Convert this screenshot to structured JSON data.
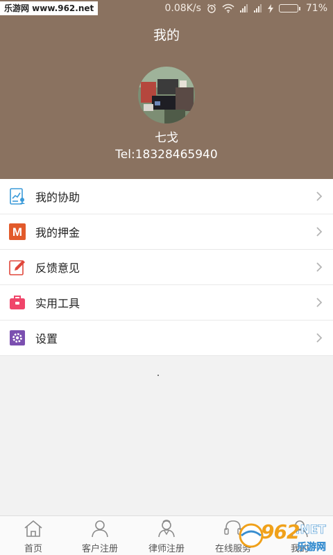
{
  "status_bar": {
    "watermark": "乐游网 www.962.net",
    "speed": "0.08K/s",
    "battery_percent": "71%",
    "battery_level": 0.71
  },
  "header": {
    "title": "我的",
    "username": "七戈",
    "phone": "Tel:18328465940"
  },
  "menu": {
    "items": [
      {
        "label": "我的协助",
        "icon": "assist-chart-icon",
        "color": "#3a9ad9"
      },
      {
        "label": "我的押金",
        "icon": "deposit-m-icon",
        "color": "#e25a2b",
        "glyph": "M"
      },
      {
        "label": "反馈意见",
        "icon": "feedback-pencil-icon",
        "color": "#e0463a"
      },
      {
        "label": "实用工具",
        "icon": "toolbox-icon",
        "color": "#f0456a"
      },
      {
        "label": "设置",
        "icon": "settings-gear-icon",
        "color": "#7b4fb0"
      }
    ]
  },
  "tabbar": {
    "tabs": [
      {
        "label": "首页",
        "icon": "home-icon"
      },
      {
        "label": "客户注册",
        "icon": "customer-icon"
      },
      {
        "label": "律师注册",
        "icon": "lawyer-icon"
      },
      {
        "label": "在线服务",
        "icon": "online-service-icon"
      },
      {
        "label": "我的",
        "icon": "me-icon"
      }
    ]
  },
  "overlay_watermark": {
    "number": "962",
    "net": ".NET",
    "cn": "乐游网"
  }
}
